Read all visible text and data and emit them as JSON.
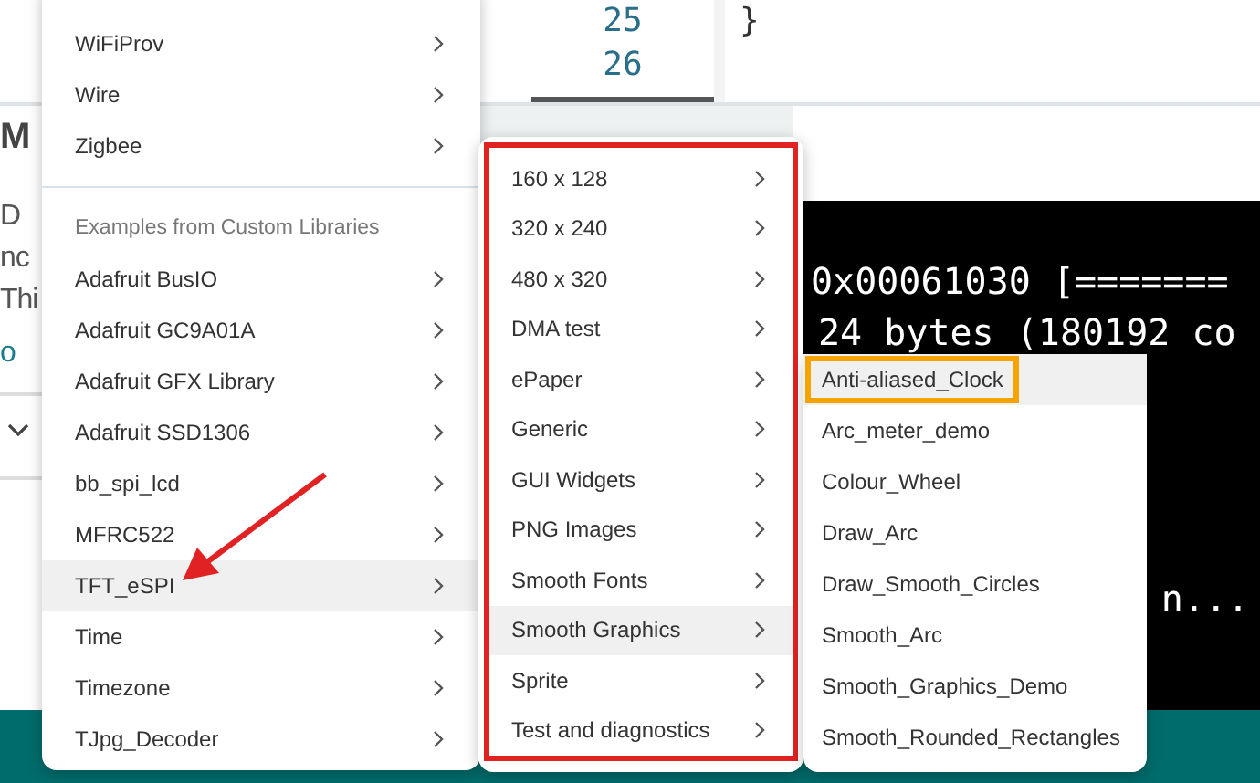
{
  "editor": {
    "line_numbers": [
      "25",
      "26"
    ],
    "code_lines": [
      "}"
    ]
  },
  "side_panel": {
    "heading": "M",
    "text_lines": [
      "D",
      "nc",
      "Thi"
    ],
    "link": "o"
  },
  "console": {
    "lines": [
      "0x00061030 [=======",
      "24 bytes (180192 co"
    ],
    "trailing_text": "n..."
  },
  "menus": [
    {
      "outlined": false,
      "items": [
        {
          "kind": "submenu",
          "label": "WiFiProv",
          "selected": false,
          "outlined": false
        },
        {
          "kind": "submenu",
          "label": "Wire",
          "selected": false,
          "outlined": false
        },
        {
          "kind": "submenu",
          "label": "Zigbee",
          "selected": false,
          "outlined": false
        },
        {
          "kind": "divider"
        },
        {
          "kind": "header",
          "label": "Examples from Custom Libraries"
        },
        {
          "kind": "submenu",
          "label": "Adafruit BusIO",
          "selected": false,
          "outlined": false
        },
        {
          "kind": "submenu",
          "label": "Adafruit GC9A01A",
          "selected": false,
          "outlined": false
        },
        {
          "kind": "submenu",
          "label": "Adafruit GFX Library",
          "selected": false,
          "outlined": false
        },
        {
          "kind": "submenu",
          "label": "Adafruit SSD1306",
          "selected": false,
          "outlined": false
        },
        {
          "kind": "submenu",
          "label": "bb_spi_lcd",
          "selected": false,
          "outlined": false
        },
        {
          "kind": "submenu",
          "label": "MFRC522",
          "selected": false,
          "outlined": false
        },
        {
          "kind": "submenu",
          "label": "TFT_eSPI",
          "selected": true,
          "outlined": false
        },
        {
          "kind": "submenu",
          "label": "Time",
          "selected": false,
          "outlined": false
        },
        {
          "kind": "submenu",
          "label": "Timezone",
          "selected": false,
          "outlined": false
        },
        {
          "kind": "submenu",
          "label": "TJpg_Decoder",
          "selected": false,
          "outlined": false
        }
      ]
    },
    {
      "outlined": true,
      "items": [
        {
          "kind": "submenu",
          "label": "160 x 128",
          "selected": false,
          "outlined": false
        },
        {
          "kind": "submenu",
          "label": "320 x 240",
          "selected": false,
          "outlined": false
        },
        {
          "kind": "submenu",
          "label": "480 x 320",
          "selected": false,
          "outlined": false
        },
        {
          "kind": "submenu",
          "label": "DMA test",
          "selected": false,
          "outlined": false
        },
        {
          "kind": "submenu",
          "label": "ePaper",
          "selected": false,
          "outlined": false
        },
        {
          "kind": "submenu",
          "label": "Generic",
          "selected": false,
          "outlined": false
        },
        {
          "kind": "submenu",
          "label": "GUI Widgets",
          "selected": false,
          "outlined": false
        },
        {
          "kind": "submenu",
          "label": "PNG Images",
          "selected": false,
          "outlined": false
        },
        {
          "kind": "submenu",
          "label": "Smooth Fonts",
          "selected": false,
          "outlined": false
        },
        {
          "kind": "submenu",
          "label": "Smooth Graphics",
          "selected": true,
          "outlined": false
        },
        {
          "kind": "submenu",
          "label": "Sprite",
          "selected": false,
          "outlined": false
        },
        {
          "kind": "submenu",
          "label": "Test and diagnostics",
          "selected": false,
          "outlined": false
        }
      ]
    },
    {
      "outlined": false,
      "items": [
        {
          "kind": "item",
          "label": "Anti-aliased_Clock",
          "selected": true,
          "outlined": true
        },
        {
          "kind": "item",
          "label": "Arc_meter_demo",
          "selected": false,
          "outlined": false
        },
        {
          "kind": "item",
          "label": "Colour_Wheel",
          "selected": false,
          "outlined": false
        },
        {
          "kind": "item",
          "label": "Draw_Arc",
          "selected": false,
          "outlined": false
        },
        {
          "kind": "item",
          "label": "Draw_Smooth_Circles",
          "selected": false,
          "outlined": false
        },
        {
          "kind": "item",
          "label": "Smooth_Arc",
          "selected": false,
          "outlined": false
        },
        {
          "kind": "item",
          "label": "Smooth_Graphics_Demo",
          "selected": false,
          "outlined": false
        },
        {
          "kind": "item",
          "label": "Smooth_Rounded_Rectangles",
          "selected": false,
          "outlined": false
        }
      ]
    }
  ]
}
